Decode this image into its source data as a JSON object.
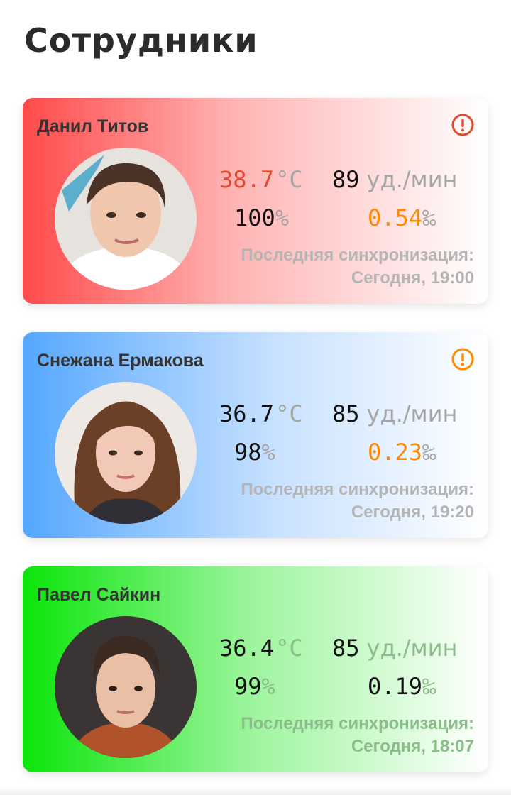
{
  "header": {
    "title": "Сотрудники"
  },
  "colors": {
    "danger": "#e04a2f",
    "warning": "#ff8a00",
    "unit_gray": "#a6a6a6"
  },
  "sync_label": "Последняя синхронизация:",
  "employees": [
    {
      "name": "Данил Титов",
      "alert": true,
      "alert_color": "#e04a2f",
      "temperature": "38.7",
      "temperature_unit": "°C",
      "temperature_status": "danger",
      "pulse": "89",
      "pulse_unit": "уд./мин",
      "oxygen": "100",
      "oxygen_unit": "%",
      "alcohol": "0.54",
      "alcohol_unit": "‰",
      "alcohol_status": "warning",
      "last_sync": "Сегодня, 19:00"
    },
    {
      "name": "Снежана Ермакова",
      "alert": true,
      "alert_color": "#ff8a00",
      "temperature": "36.7",
      "temperature_unit": "°C",
      "temperature_status": "normal",
      "pulse": "85",
      "pulse_unit": "уд./мин",
      "oxygen": "98",
      "oxygen_unit": "%",
      "alcohol": "0.23",
      "alcohol_unit": "‰",
      "alcohol_status": "warning",
      "last_sync": "Сегодня, 19:20"
    },
    {
      "name": "Павел Сайкин",
      "alert": false,
      "temperature": "36.4",
      "temperature_unit": "°C",
      "temperature_status": "normal",
      "pulse": "85",
      "pulse_unit": "уд./мин",
      "oxygen": "99",
      "oxygen_unit": "%",
      "alcohol": "0.19",
      "alcohol_unit": "‰",
      "alcohol_status": "normal",
      "last_sync": "Сегодня, 18:07"
    }
  ]
}
